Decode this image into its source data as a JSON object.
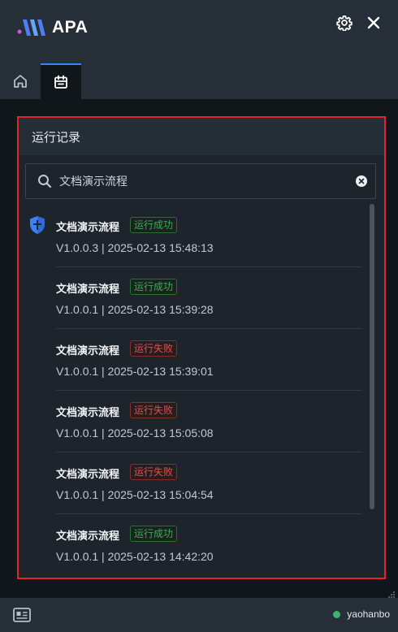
{
  "app": {
    "name": "APA"
  },
  "colors": {
    "accent": "#3b82f6",
    "highlight": "#e0262c",
    "success": "#3fa858",
    "fail": "#d9534f",
    "online": "#3cb371"
  },
  "panel": {
    "title": "运行记录"
  },
  "search": {
    "value": "文档演示流程",
    "placeholder": ""
  },
  "records": [
    {
      "name": "文档演示流程",
      "status": "运行成功",
      "status_type": "success",
      "meta": "V1.0.0.3 | 2025-02-13 15:48:13"
    },
    {
      "name": "文档演示流程",
      "status": "运行成功",
      "status_type": "success",
      "meta": "V1.0.0.1 | 2025-02-13 15:39:28"
    },
    {
      "name": "文档演示流程",
      "status": "运行失败",
      "status_type": "fail",
      "meta": "V1.0.0.1 | 2025-02-13 15:39:01"
    },
    {
      "name": "文档演示流程",
      "status": "运行失败",
      "status_type": "fail",
      "meta": "V1.0.0.1 | 2025-02-13 15:05:08"
    },
    {
      "name": "文档演示流程",
      "status": "运行失败",
      "status_type": "fail",
      "meta": "V1.0.0.1 | 2025-02-13 15:04:54"
    },
    {
      "name": "文档演示流程",
      "status": "运行成功",
      "status_type": "success",
      "meta": "V1.0.0.1 | 2025-02-13 14:42:20"
    }
  ],
  "statusbar": {
    "username": "yaohanbo"
  },
  "icons": {
    "logo": "apa-logo-icon",
    "settings": "gear-icon",
    "close": "close-icon",
    "home_tab": "home-icon",
    "calendar_tab": "calendar-icon",
    "search": "search-icon",
    "clear": "clear-icon",
    "shield": "shield-icon",
    "card": "id-card-icon"
  }
}
